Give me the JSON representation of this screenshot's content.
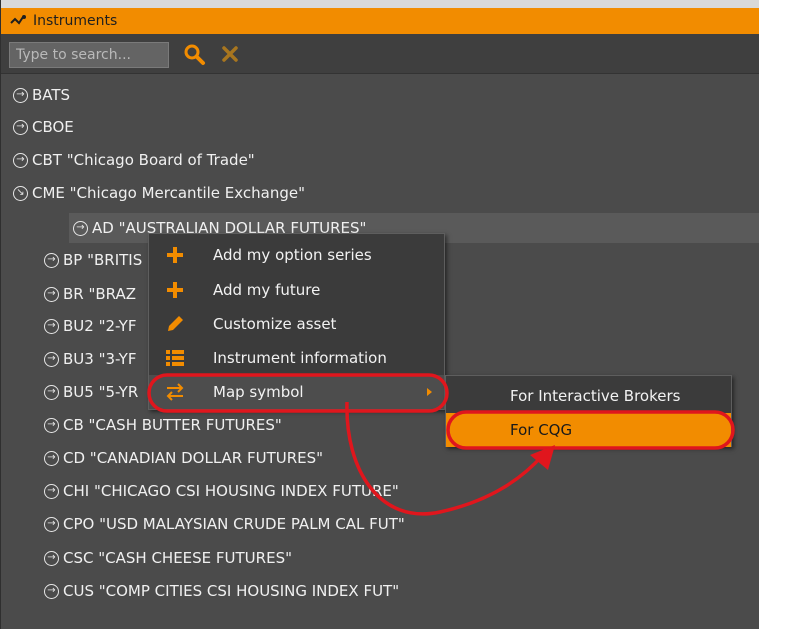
{
  "window": {
    "title": "Instruments"
  },
  "search": {
    "placeholder": "Type to search...",
    "value": ""
  },
  "tree": {
    "exchanges": [
      {
        "label": "BATS",
        "expanded": false
      },
      {
        "label": "CBOE",
        "expanded": false
      },
      {
        "label": "CBT \"Chicago Board of Trade\"",
        "expanded": false
      },
      {
        "label": "CME \"Chicago Mercantile Exchange\"",
        "expanded": true
      }
    ],
    "instruments": [
      {
        "label": "AD \"AUSTRALIAN DOLLAR FUTURES\""
      },
      {
        "label": "BP \"BRITIS"
      },
      {
        "label": "BR \"BRAZ"
      },
      {
        "label": "BU2 \"2-YF"
      },
      {
        "label": "BU3 \"3-YF"
      },
      {
        "label": "BU5 \"5-YR"
      },
      {
        "label": "CB \"CASH BUTTER FUTURES\""
      },
      {
        "label": "CD \"CANADIAN DOLLAR FUTURES\""
      },
      {
        "label": "CHI \"CHICAGO CSI HOUSING INDEX FUTURE\""
      },
      {
        "label": "CPO \"USD MALAYSIAN CRUDE PALM CAL FUT\""
      },
      {
        "label": "CSC \"CASH CHEESE FUTURES\""
      },
      {
        "label": "CUS \"COMP CITIES CSI HOUSING INDEX FUT\""
      }
    ]
  },
  "context_menu": {
    "items": [
      {
        "label": "Add my option series",
        "icon": "plus-icon"
      },
      {
        "label": "Add my future",
        "icon": "plus-icon"
      },
      {
        "label": "Customize asset",
        "icon": "pencil-icon"
      },
      {
        "label": "Instrument information",
        "icon": "list-icon"
      },
      {
        "label": "Map symbol",
        "icon": "swap-arrows-icon"
      }
    ]
  },
  "submenu": {
    "items": [
      {
        "label": "For Interactive Brokers"
      },
      {
        "label": "For CQG"
      }
    ]
  },
  "colors": {
    "accent": "#f28c00",
    "panel": "#4b4b4b",
    "menu": "#3b3b3b",
    "annotation": "#e0161d"
  }
}
